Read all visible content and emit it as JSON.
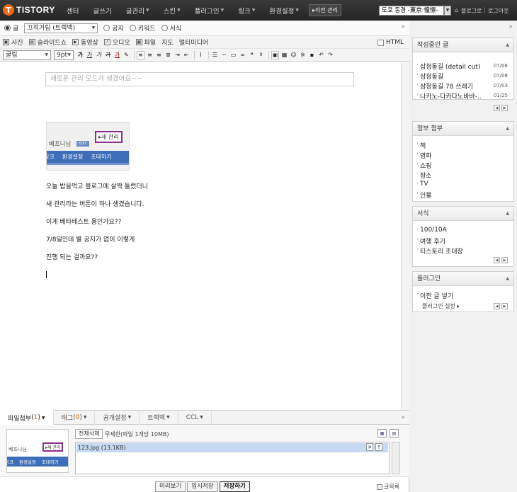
{
  "topbar": {
    "logo_letter": "T",
    "logo_text": "TISTORY",
    "nav": [
      {
        "label": "센터",
        "caret": false
      },
      {
        "label": "글쓰기",
        "caret": false
      },
      {
        "label": "글관리",
        "caret": true
      },
      {
        "label": "스킨",
        "caret": true
      },
      {
        "label": "플러그인",
        "caret": true
      },
      {
        "label": "링크",
        "caret": true
      },
      {
        "label": "환경설정",
        "caret": true
      }
    ],
    "old_admin_label": "▸이전 관리",
    "blog_select_value": "도쿄 동경 -東京 憧憬-",
    "blog_link": "블로그로",
    "logout_link": "로그아웃"
  },
  "editor": {
    "type_options": [
      {
        "label": "글",
        "checked": true
      },
      {
        "label": "공지",
        "checked": false
      },
      {
        "label": "키워드",
        "checked": false
      },
      {
        "label": "서식",
        "checked": false
      }
    ],
    "category_value": "끄적거림 (트랙백)",
    "media": [
      "사진",
      "슬라이드쇼",
      "동영상",
      "오디오",
      "파일",
      "지도",
      "멀티미디어"
    ],
    "html_label": "HTML",
    "font_family": "굴림",
    "font_size": "9pt",
    "format_buttons": [
      "가",
      "가",
      "가",
      "가",
      "가"
    ],
    "title_placeholder": "새로운 관리 모드가 생겼어요~~",
    "thumb": {
      "blog_name": "베프니님",
      "badge": "EDIT",
      "admin_btn": "▸새 관리",
      "menu": [
        "링크",
        "환경설정",
        "초대하기"
      ]
    },
    "paragraphs": [
      "오늘 밥을먹고 블로그에 살짝 들렀더니",
      "새 관리라는 버튼이 하나 생겼습니다.",
      "이게 베타테스트 용인가요??",
      "7/8일인데 별 공지가 없이 이렇게",
      "진행 되는 걸까요??"
    ]
  },
  "bottom": {
    "tabs": [
      {
        "label": "파일첨부",
        "count": "1"
      },
      {
        "label": "태그",
        "count": "0"
      },
      {
        "label": "공개설정",
        "count": ""
      },
      {
        "label": "트랙백",
        "count": ""
      },
      {
        "label": "CCL",
        "count": ""
      }
    ],
    "delete_all": "전체삭제",
    "limit_text": "무제한(파일 1개당 10MB)",
    "file_name": "123.jpg (13.1KB)",
    "attach_thumb": {
      "blog_name": "베프니님",
      "admin_btn": "▸새 관리",
      "menu": [
        "링크",
        "환경설정",
        "초대하기"
      ]
    },
    "buttons": {
      "preview": "미리보기",
      "temp_save": "임시저장",
      "save": "저장하기"
    },
    "list_link": "글목록"
  },
  "sidebar": {
    "widgets": [
      {
        "title": "작성중인 글",
        "items": [
          {
            "text": "삽청동길 (detail cut)",
            "date": "07/08"
          },
          {
            "text": "삼청동길",
            "date": "07/08"
          },
          {
            "text": "삼청동길 78 쓰레기",
            "date": "07/03"
          },
          {
            "text": "나카노-다카다노바바-..",
            "date": "01/25"
          }
        ]
      },
      {
        "title": "정보 첨부",
        "items": [
          {
            "text": "책"
          },
          {
            "text": "영화"
          },
          {
            "text": "쇼핑"
          },
          {
            "text": "장소"
          },
          {
            "text": "TV"
          },
          {
            "text": "인물"
          }
        ]
      },
      {
        "title": "서식",
        "items": [
          {
            "text": "100/10A"
          },
          {
            "text": "여행 후기"
          },
          {
            "text": "티스토리 초대장"
          }
        ]
      },
      {
        "title": "플러그인",
        "items": [
          {
            "text": "이전 글 넣기"
          }
        ],
        "sub": "플러그인 설정 ▸"
      }
    ]
  }
}
